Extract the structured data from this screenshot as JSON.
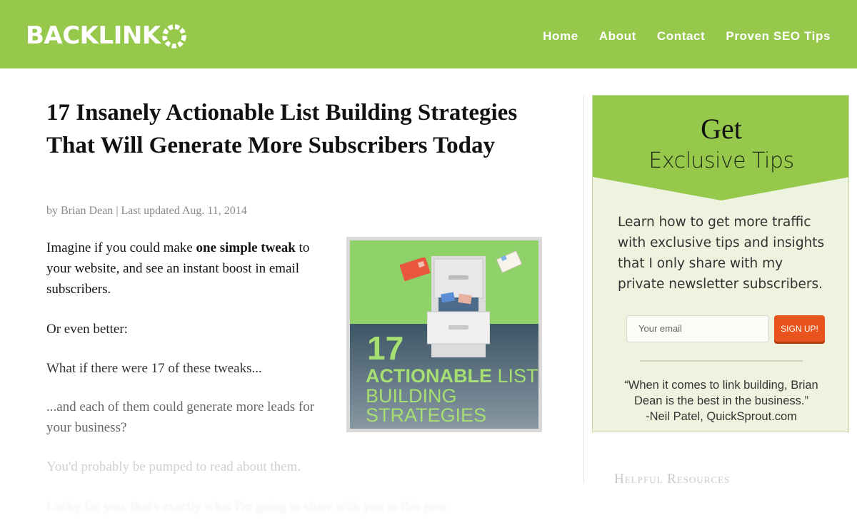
{
  "header": {
    "logo_text": "BACKLINK",
    "logo_o": "O",
    "nav": [
      "Home",
      "About",
      "Contact",
      "Proven SEO Tips"
    ]
  },
  "article": {
    "title": "17 Insanely Actionable List Building Strategies That Will Generate More Subscribers Today",
    "byline_author": "by Brian Dean",
    "byline_sep": " | ",
    "byline_date": "Last updated Aug. 11, 2014",
    "p1_a": "Imagine if you could make ",
    "p1_b": "one simple tweak",
    "p1_c": " to your website, and see an instant boost in email subscribers.",
    "p2": "Or even better:",
    "p3": "What if there were 17 of these tweaks...",
    "p4": "...and each of them could generate more leads for your business?",
    "p5": "You'd probably be pumped to read about them.",
    "p6": "Lucky for you, that's exactly what I'm going to share with you in this post.",
    "image": {
      "number": "17",
      "line1_bold": "ACTIONABLE",
      "line1_rest": " LIST",
      "line2": "BUILDING",
      "line3": "STRATEGIES"
    }
  },
  "sidebar": {
    "optin": {
      "heading_get": "Get",
      "heading_tips": "Exclusive Tips",
      "body": "Learn how to get more traffic with exclusive tips and insights that I only share with my private newsletter subscribers.",
      "email_placeholder": "Your email",
      "signup_label": "SIGN UP!",
      "quote_line1": "“When it comes to link building, Brian",
      "quote_line2": "Dean is the best in the business.”",
      "quote_line3": "-Neil Patel, QuickSprout.com"
    },
    "resources_heading": "Helpful Resources"
  },
  "colors": {
    "brand_green": "#96c84c",
    "signup_orange": "#e9531d",
    "optin_background": "#eef3df"
  }
}
